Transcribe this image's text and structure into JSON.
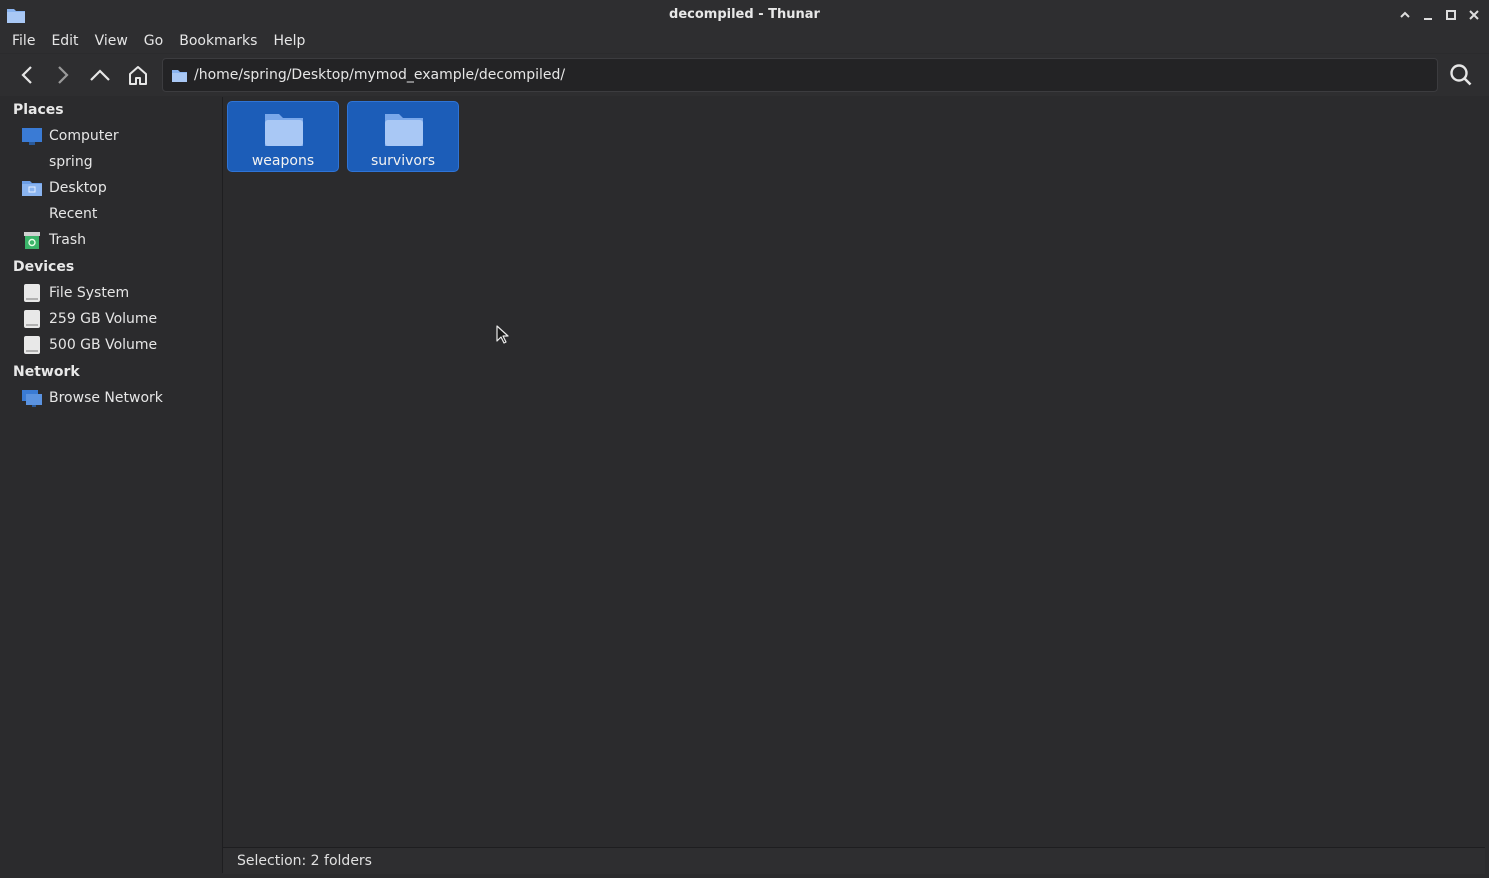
{
  "window": {
    "title": "decompiled - Thunar"
  },
  "menubar": [
    "File",
    "Edit",
    "View",
    "Go",
    "Bookmarks",
    "Help"
  ],
  "toolbar": {
    "location_path": "/home/spring/Desktop/mymod_example/decompiled/"
  },
  "sidebar": {
    "places_title": "Places",
    "places": [
      {
        "label": "Computer",
        "icon": "computer-icon"
      },
      {
        "label": "spring",
        "icon": "home-icon"
      },
      {
        "label": "Desktop",
        "icon": "desktop-folder-icon"
      },
      {
        "label": "Recent",
        "icon": "recent-icon"
      },
      {
        "label": "Trash",
        "icon": "trash-icon"
      }
    ],
    "devices_title": "Devices",
    "devices": [
      {
        "label": "File System",
        "icon": "drive-icon"
      },
      {
        "label": "259 GB Volume",
        "icon": "drive-icon"
      },
      {
        "label": "500 GB Volume",
        "icon": "drive-icon"
      }
    ],
    "network_title": "Network",
    "network": [
      {
        "label": "Browse Network",
        "icon": "network-icon"
      }
    ]
  },
  "files": [
    {
      "name": "weapons",
      "icon": "folder-icon",
      "selected": true
    },
    {
      "name": "survivors",
      "icon": "folder-icon",
      "selected": true
    }
  ],
  "status": {
    "text": "Selection: 2 folders"
  },
  "colors": {
    "selection": "#1c5db8",
    "folder": "#8ab4f0",
    "background": "#2b2b2d"
  }
}
